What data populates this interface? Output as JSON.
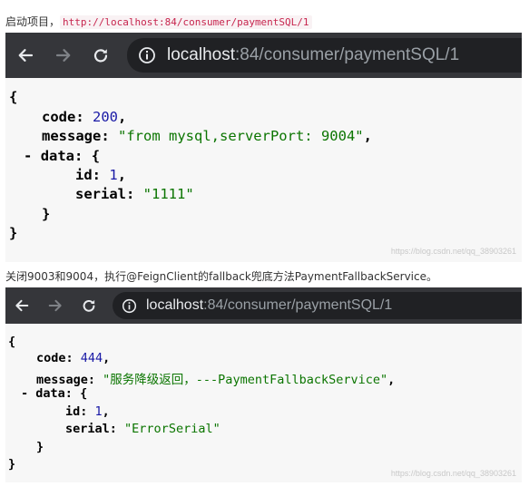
{
  "caption1": {
    "text": "启动项目，",
    "url": "http://localhost:84/consumer/paymentSQL/1"
  },
  "caption2": {
    "text": "关闭9003和9004，执行@FeignClient的fallback兜底方法PaymentFallbackService。"
  },
  "browser1": {
    "url_host": "localhost",
    "url_rest": ":84/consumer/paymentSQL/1",
    "json": {
      "open_brace": "{",
      "code_key": "code",
      "code_value": "200",
      "message_key": "message",
      "message_value": "\"from mysql,serverPort: 9004\"",
      "collapse_marker": "-",
      "data_key": "data",
      "data_open": "{",
      "id_key": "id",
      "id_value": "1",
      "serial_key": "serial",
      "serial_value": "\"1111\"",
      "data_close": "}",
      "close_brace": "}"
    },
    "watermark": "https://blog.csdn.net/qq_38903261"
  },
  "browser2": {
    "url_host": "localhost",
    "url_rest": ":84/consumer/paymentSQL/1",
    "json": {
      "open_brace": "{",
      "code_key": "code",
      "code_value": "444",
      "message_key": "message",
      "message_value": "\"服务降级返回，---PaymentFallbackService\"",
      "collapse_marker": "-",
      "data_key": "data",
      "data_open": "{",
      "id_key": "id",
      "id_value": "1",
      "serial_key": "serial",
      "serial_value": "\"ErrorSerial\"",
      "data_close": "}",
      "close_brace": "}"
    },
    "watermark": "https://blog.csdn.net/qq_38903261"
  },
  "icons": [
    "back-arrow-icon",
    "forward-arrow-icon",
    "reload-icon",
    "info-icon"
  ],
  "colors": {
    "toolbar": "#35363a",
    "omnibox": "#202124",
    "url_host": "#e8eaed",
    "url_path": "#9aa0a6",
    "json_number": "#1a1aa6",
    "json_string": "#0b7500",
    "caption_code": "#c7254e"
  }
}
